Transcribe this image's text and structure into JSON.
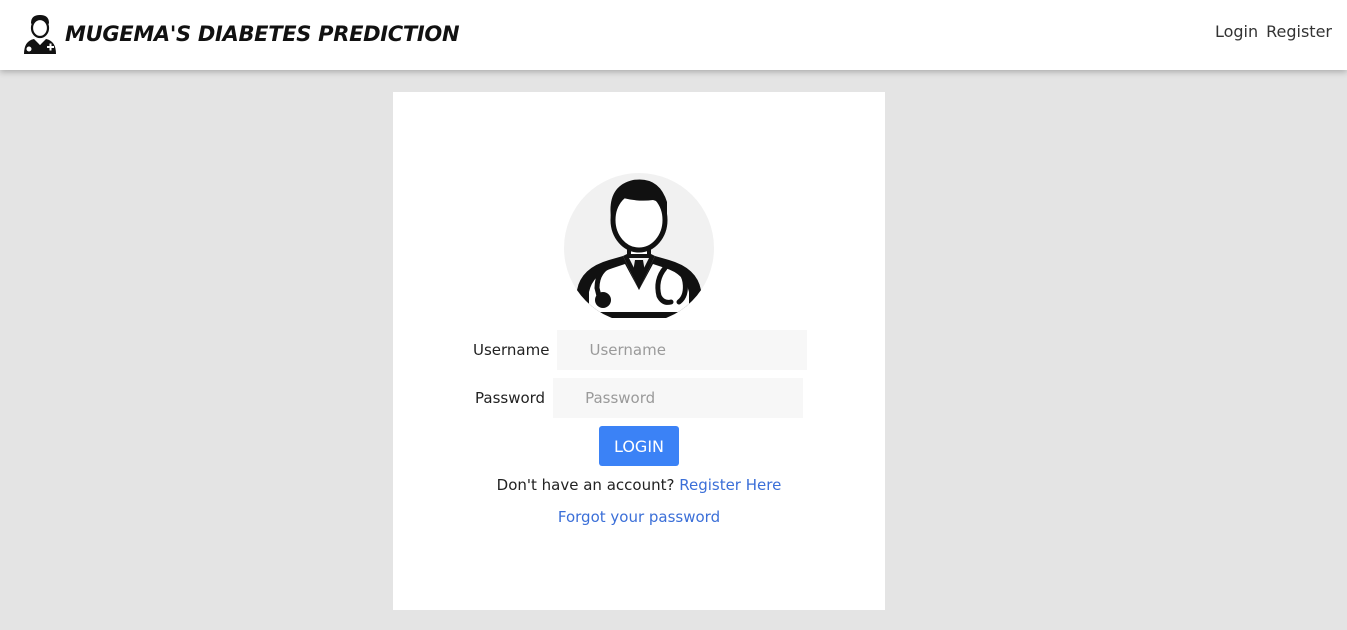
{
  "navbar": {
    "brand_title": "MUGEMA'S DIABETES PREDICTION",
    "logo_icon": "doctor-icon",
    "links": [
      {
        "label": "Login"
      },
      {
        "label": "Register"
      }
    ]
  },
  "login_form": {
    "avatar_icon": "doctor-avatar-icon",
    "username_label": "Username",
    "username_placeholder": "Username",
    "username_value": "",
    "password_label": "Password",
    "password_placeholder": "Password",
    "password_value": "",
    "login_button_label": "LOGIN",
    "no_account_text": "Don't have an account?",
    "register_link_label": "Register Here",
    "forgot_password_label": "Forgot your password"
  },
  "colors": {
    "page_background": "#e4e4e4",
    "card_background": "#ffffff",
    "button_primary": "#3b82f6",
    "link": "#3b6fd8",
    "input_background": "#f7f7f7"
  }
}
